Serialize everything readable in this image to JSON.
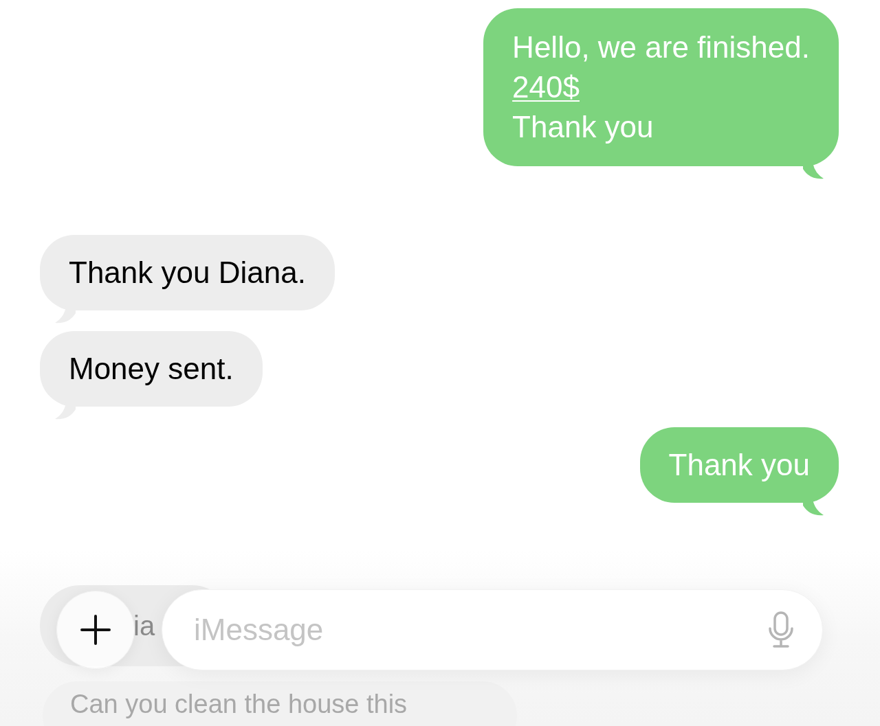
{
  "messages": [
    {
      "kind": "sent",
      "lines": [
        {
          "text": "Hello, we are finished.",
          "link": false
        },
        {
          "text": "240$",
          "link": true
        },
        {
          "text": "Thank you",
          "link": false
        }
      ]
    },
    {
      "kind": "received",
      "lines": [
        {
          "text": "Thank you Diana.",
          "link": false
        }
      ]
    },
    {
      "kind": "received",
      "lines": [
        {
          "text": "Money sent.",
          "link": false
        }
      ]
    },
    {
      "kind": "sent",
      "lines": [
        {
          "text": "Thank you",
          "link": false
        }
      ]
    }
  ],
  "composer": {
    "behind_text": "ia",
    "placeholder": "iMessage",
    "preview_text": "Can you clean the house this"
  }
}
